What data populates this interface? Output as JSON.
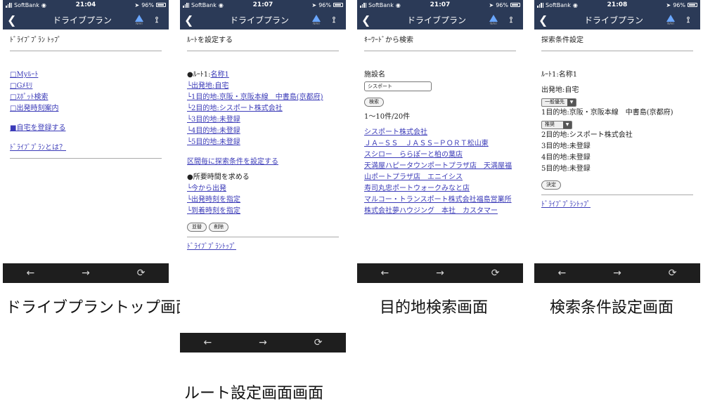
{
  "status_bars": [
    {
      "carrier": "SoftBank",
      "time": "21:04",
      "battery": "96%"
    },
    {
      "carrier": "SoftBank",
      "time": "21:07",
      "battery": "96%"
    },
    {
      "carrier": "SoftBank",
      "time": "21:07",
      "battery": "96%"
    },
    {
      "carrier": "SoftBank",
      "time": "21:08",
      "battery": "96%"
    }
  ],
  "nav": {
    "title": "ドライブプラン",
    "nav_icon_sub": "NAVI"
  },
  "toolbar": {
    "back": "←",
    "forward": "→",
    "reload": "⟳"
  },
  "screen1": {
    "title": "ﾄﾞﾗｲﾌﾞﾌﾟﾗﾝ ﾄｯﾌﾟ",
    "links": [
      "□Myﾙｰﾄ",
      "□Gﾒﾓﾘ",
      "□ｽﾎﾟｯﾄ検索",
      "□出発時刻案内"
    ],
    "register_home": "■自宅を登録する",
    "about": "ﾄﾞﾗｲﾌﾞﾌﾟﾗﾝとは？",
    "caption": "ドライブプラントップ画面"
  },
  "screen2": {
    "title": "ﾙｰﾄを設定する",
    "route_prefix": "●ﾙｰﾄ1:",
    "route_name": "名称1",
    "items": [
      "└出発地:自宅",
      "└1目的地:京阪・京阪本線　中書島(京都府)",
      "└2目的地:シスポート株式会社",
      "└3目的地:未登録",
      "└4目的地:未登録",
      "└5目的地:未登録"
    ],
    "section_link": "区間毎に探索条件を設定する",
    "time_heading": "●所要時間を求める",
    "time_links": [
      "└今から出発",
      "└出発時刻を指定",
      "└到着時刻を指定"
    ],
    "btn_swap": "並替",
    "btn_delete": "削除",
    "back_link": "ﾄﾞﾗｲﾌﾞﾌﾟﾗﾝﾄｯﾌﾟ",
    "caption": "ルート設定画面画面"
  },
  "screen3": {
    "title": "ｷｰﾜｰﾄﾞから検索",
    "field_label": "施設名",
    "field_value": "シスポート",
    "search_btn": "検索",
    "count": "1〜10件/20件",
    "results": [
      "シスポート株式会社",
      "ＪＡ−ＳＳ　ＪＡＳＳ−ＰＯＲＴ松山東",
      "スシロー　ららぽーと柏の葉店",
      "天満屋ハピータウンポートプラザ店　天満屋福山ポートプラザ店　エニイシス",
      "寿司丸忠ポートウォークみなと店",
      "マルコー・トランスポート株式会社福島営業所",
      "株式会社夢ハウジング　本社　カスタマー"
    ],
    "caption": "目的地検索画面"
  },
  "screen4": {
    "title": "探索条件設定",
    "route": "ﾙｰﾄ1:名称1",
    "origin": "出発地:自宅",
    "select1": "一般優先",
    "dest1": "1目的地:京阪・京阪本線　中書島(京都府)",
    "select2": "推奨",
    "dests": [
      "2目的地:シスポート株式会社",
      "3目的地:未登録",
      "4目的地:未登録",
      "5目的地:未登録"
    ],
    "decide_btn": "決定",
    "back_link": "ﾄﾞﾗｲﾌﾞﾌﾟﾗﾝﾄｯﾌﾟ",
    "caption": "検索条件設定画面"
  }
}
